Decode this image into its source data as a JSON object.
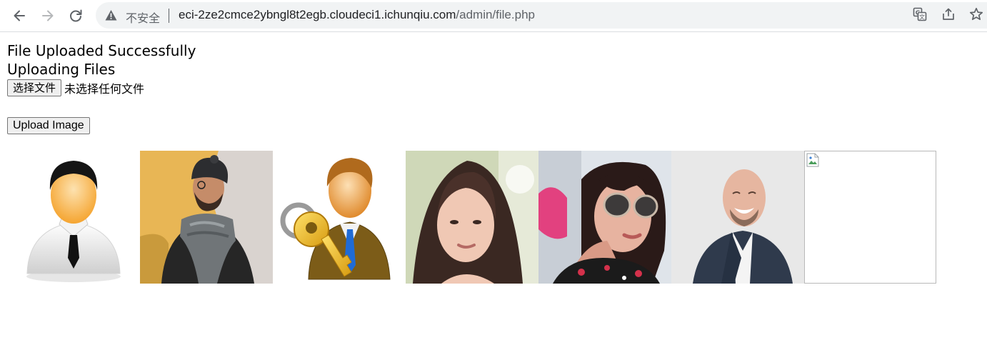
{
  "browser": {
    "security_label": "不安全",
    "url_host": "eci-2ze2cmce2ybngl8t2egb.cloudeci1.ichunqiu.com",
    "url_path": "/admin/file.php"
  },
  "page": {
    "status_message": "File Uploaded Successfully",
    "heading": "Uploading Files",
    "choose_file_label": "选择文件",
    "no_file_text": "未选择任何文件",
    "upload_button_label": "Upload Image"
  },
  "gallery": {
    "images": [
      {
        "icon": "businessman-avatar-icon"
      },
      {
        "icon": "man-with-scarf-photo"
      },
      {
        "icon": "user-key-icon"
      },
      {
        "icon": "woman-portrait-photo"
      },
      {
        "icon": "woman-sunglasses-photo"
      },
      {
        "icon": "bald-man-laughing-photo"
      },
      {
        "icon": "broken-image-icon"
      }
    ]
  },
  "colors": {
    "omnibox_bg": "#f1f3f4",
    "url_host": "#202124",
    "url_path": "#5f6368"
  }
}
